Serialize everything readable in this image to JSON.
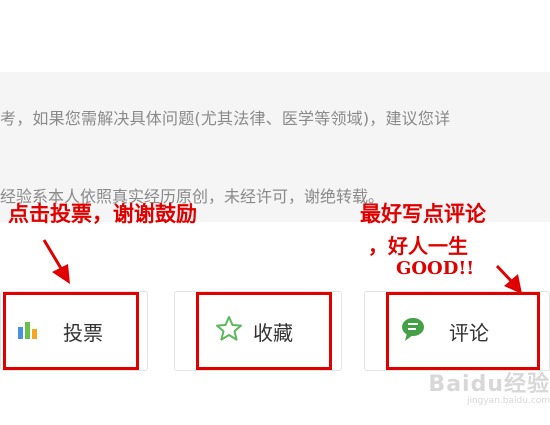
{
  "content": {
    "line1": "考，如果您需解决具体问题(尤其法律、医学等领域)，建议您详",
    "line2": "经验系本人依照真实经历原创，未经许可，谢绝转载。"
  },
  "annotations": {
    "left": "点击投票，谢谢鼓励",
    "right_line1": "最好写点评论",
    "right_line2": "，好人一生",
    "right_line3": "GOOD!!"
  },
  "buttons": {
    "vote_label": "投票",
    "favorite_label": "收藏",
    "comment_label": "评论"
  },
  "icons": {
    "vote": "bar-chart-icon",
    "favorite": "star-outline-icon",
    "comment": "speech-bubble-icon"
  },
  "watermark": {
    "main": "Baidu经验",
    "sub": "jingyan.baidu.com"
  },
  "colors": {
    "annotation": "#e00000",
    "star": "#5cb85c",
    "bubble": "#43a047"
  }
}
